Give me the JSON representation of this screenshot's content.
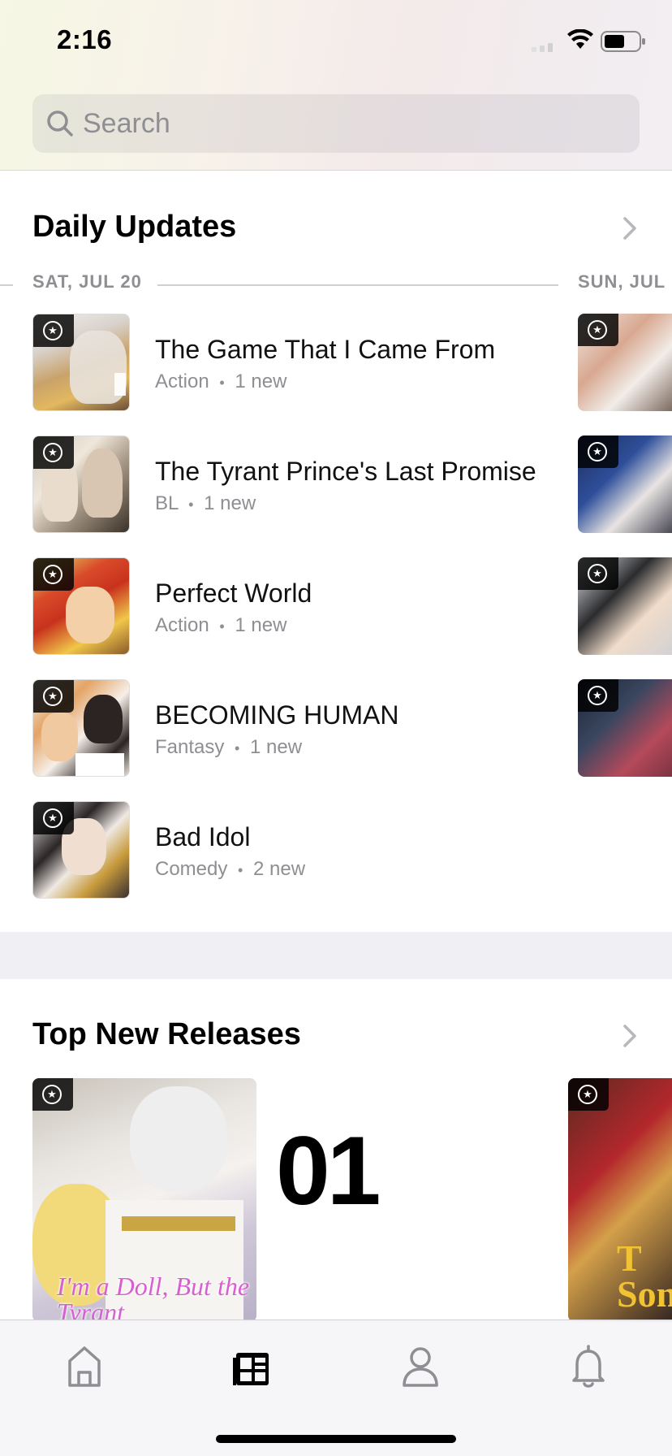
{
  "status_bar": {
    "time": "2:16"
  },
  "search": {
    "placeholder": "Search"
  },
  "daily_updates": {
    "title": "Daily Updates",
    "day_current": "SAT, JUL 20",
    "day_next": "SUN, JUL",
    "items": [
      {
        "title": "The Game That I Came From",
        "genre": "Action",
        "new_count": "1 new"
      },
      {
        "title": "The Tyrant Prince's Last Promise",
        "genre": "BL",
        "new_count": "1 new"
      },
      {
        "title": "Perfect World",
        "genre": "Action",
        "new_count": "1 new"
      },
      {
        "title": "BECOMING HUMAN",
        "genre": "Fantasy",
        "new_count": "1 new"
      },
      {
        "title": "Bad Idol",
        "genre": "Comedy",
        "new_count": "2 new"
      }
    ],
    "separator": "•"
  },
  "top_new_releases": {
    "title": "Top New Releases",
    "rank": "01",
    "cover_text": "I'm a Doll, But the Tyrant",
    "next_cover_text": "T Son"
  },
  "tabbar": {
    "tabs": [
      {
        "name": "home-icon",
        "active": false
      },
      {
        "name": "browse-icon",
        "active": true
      },
      {
        "name": "profile-icon",
        "active": false
      },
      {
        "name": "bell-icon",
        "active": false
      }
    ]
  },
  "colors": {
    "badge": "#000000",
    "meta_text": "#8e8e93",
    "band": "#f0f0f4"
  }
}
